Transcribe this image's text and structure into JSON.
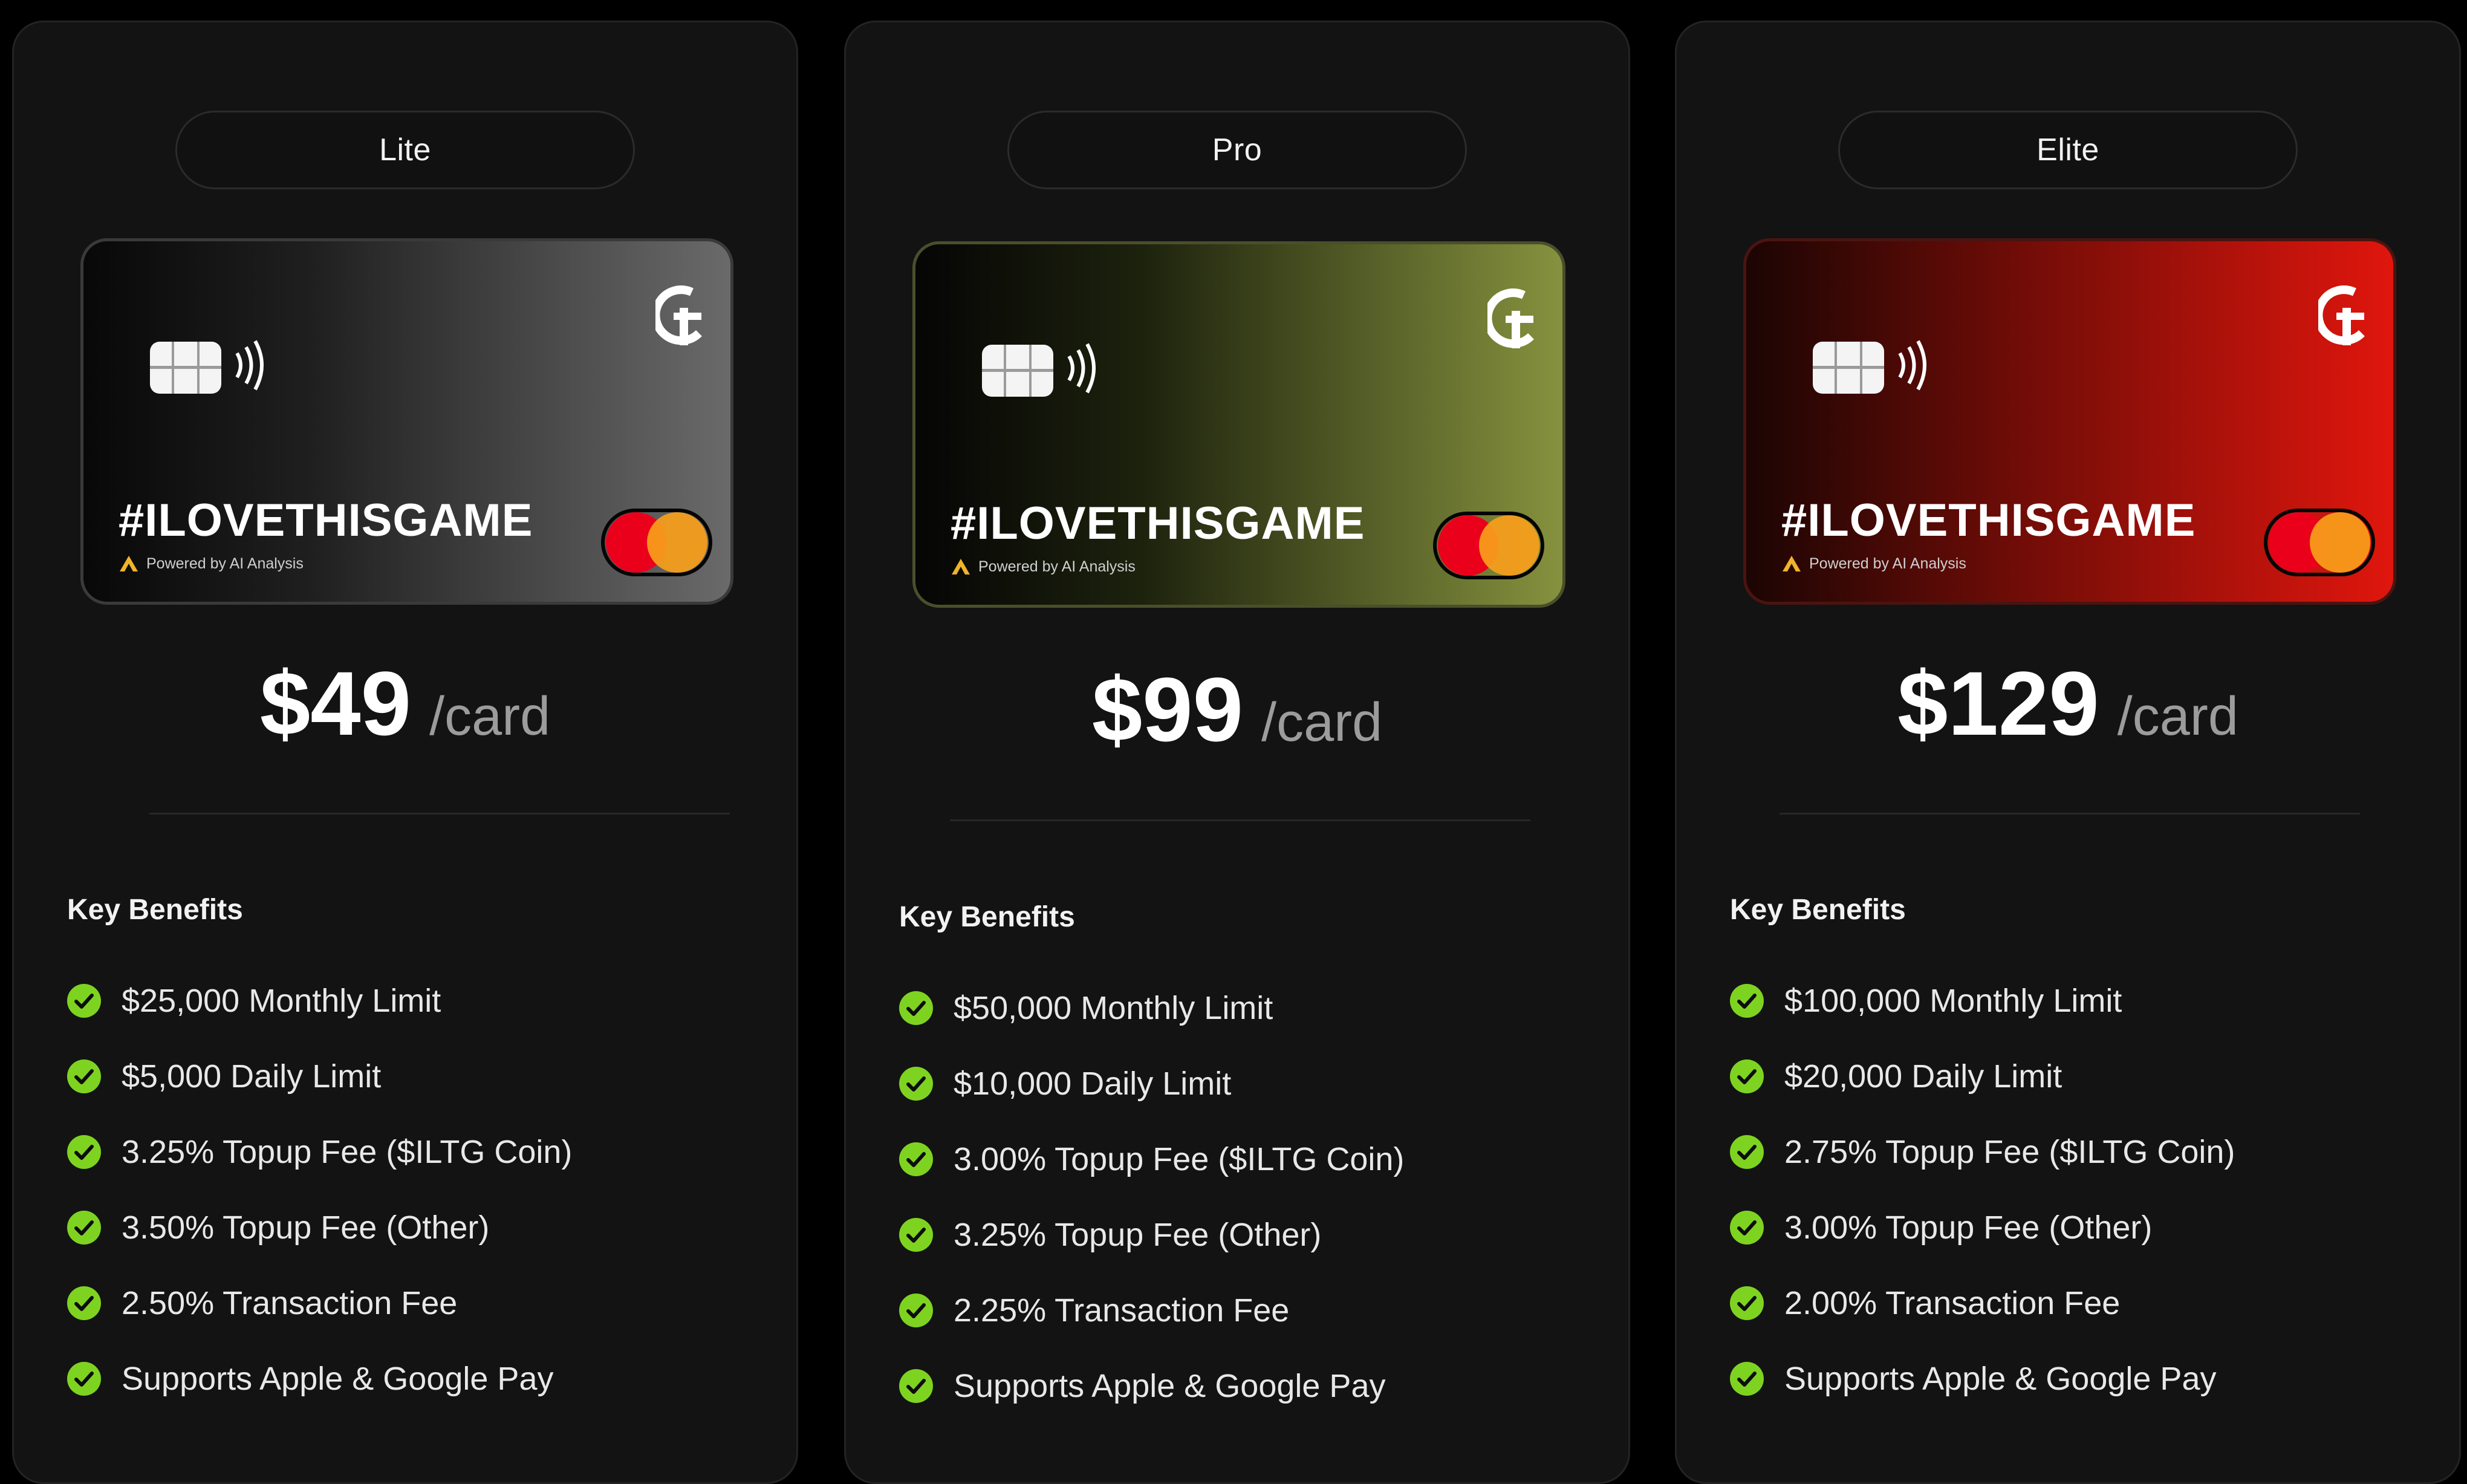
{
  "plans": [
    {
      "tier": "Lite",
      "card_slogan": "#ILOVETHISGAME",
      "powered_by": "Powered by AI Analysis",
      "price": "$49",
      "unit": "/card",
      "benefits_title": "Key Benefits",
      "benefits": [
        "$25,000 Monthly Limit",
        "$5,000 Daily Limit",
        "3.25% Topup Fee ($ILTG Coin)",
        "3.50% Topup Fee (Other)",
        "2.50% Transaction Fee",
        "Supports Apple & Google Pay"
      ]
    },
    {
      "tier": "Pro",
      "card_slogan": "#ILOVETHISGAME",
      "powered_by": "Powered by AI Analysis",
      "price": "$99",
      "unit": "/card",
      "benefits_title": "Key Benefits",
      "benefits": [
        "$50,000 Monthly Limit",
        "$10,000 Daily Limit",
        "3.00% Topup Fee ($ILTG Coin)",
        "3.25% Topup Fee (Other)",
        "2.25% Transaction Fee",
        "Supports Apple & Google Pay"
      ]
    },
    {
      "tier": "Elite",
      "card_slogan": "#ILOVETHISGAME",
      "powered_by": "Powered by AI Analysis",
      "price": "$129",
      "unit": "/card",
      "benefits_title": "Key Benefits",
      "benefits": [
        "$100,000 Monthly Limit",
        "$20,000 Daily Limit",
        "2.75% Topup Fee ($ILTG Coin)",
        "3.00% Topup Fee (Other)",
        "2.00% Transaction Fee",
        "Supports Apple & Google Pay"
      ]
    }
  ],
  "icons": {
    "check": "check-circle-icon",
    "chip": "card-chip-icon",
    "contactless": "contactless-icon",
    "brand": "brand-logo-icon",
    "network": "mastercard-logo",
    "powered_mark": "ai-analysis-logo"
  },
  "colors": {
    "check": "#7ed321",
    "lite_card": "#6a6a6a",
    "pro_card": "#86923e",
    "elite_card": "#e0160d"
  }
}
